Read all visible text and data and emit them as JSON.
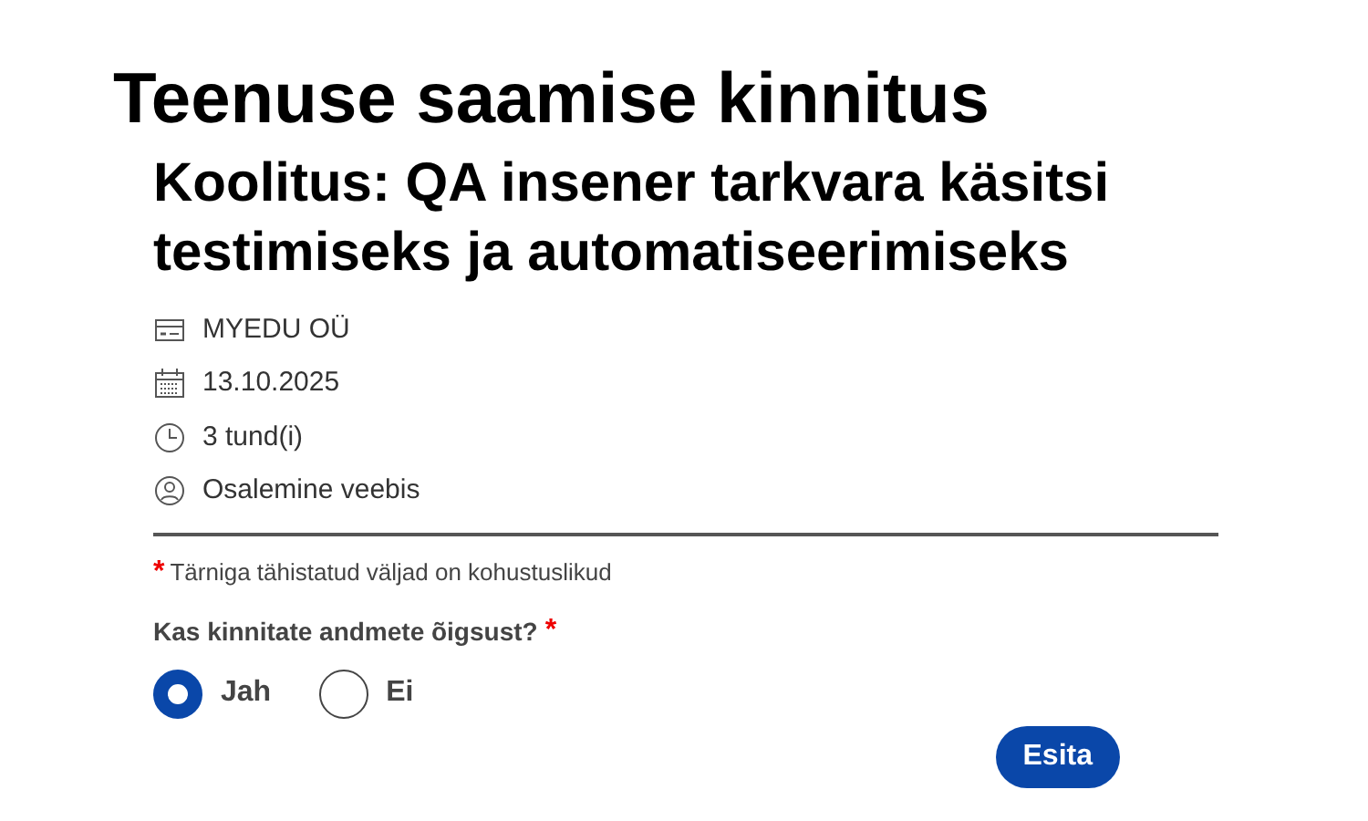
{
  "title": "Teenuse saamise kinnitus",
  "course": "Koolitus: QA insener tarkvara käsitsi testimiseks ja automatiseerimiseks",
  "details": [
    {
      "kind": "company",
      "text": "MYEDU OÜ"
    },
    {
      "kind": "date",
      "text": "13.10.2025"
    },
    {
      "kind": "duration",
      "text": "3 tund(i)"
    },
    {
      "kind": "mode",
      "text": "Osalemine veebis"
    }
  ],
  "required_note": {
    "mark": "*",
    "text": "Tärniga tähistatud väljad on kohustuslikud"
  },
  "question": {
    "label": "Kas kinnitate andmete õigsust?",
    "mark": "*",
    "options": [
      {
        "label": "Jah",
        "selected": true
      },
      {
        "label": "Ei",
        "selected": false
      }
    ]
  },
  "submit": "Esita"
}
